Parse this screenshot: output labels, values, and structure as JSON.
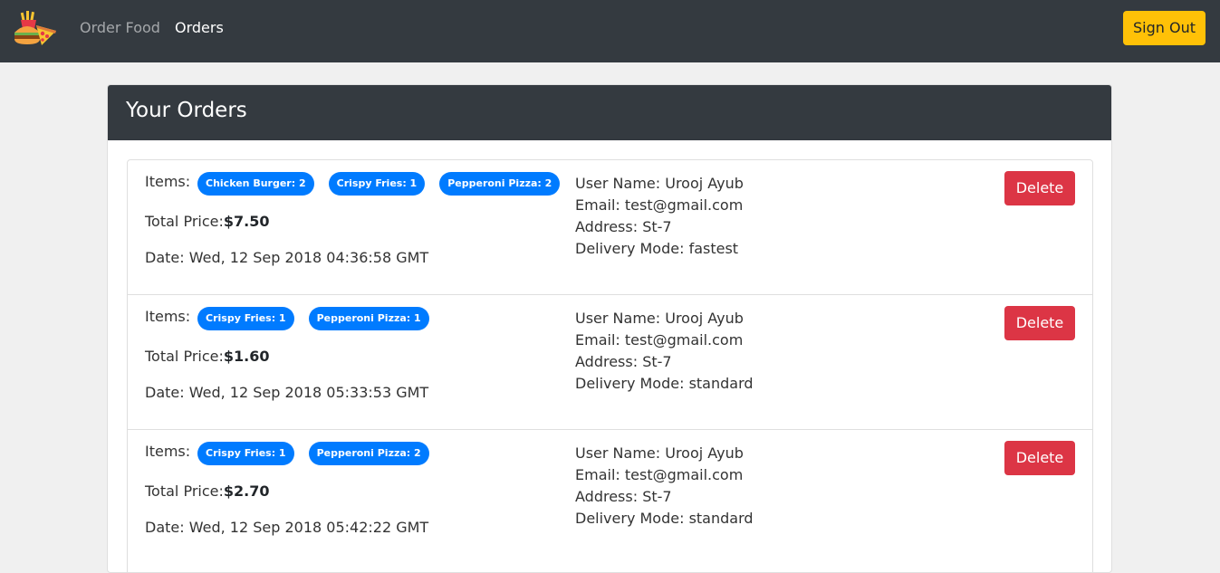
{
  "nav": {
    "logo_icon": "food-logo-icon",
    "links": [
      {
        "label": "Order Food",
        "active": false
      },
      {
        "label": "Orders",
        "active": true
      }
    ],
    "signout_label": "Sign Out"
  },
  "page": {
    "title": "Your Orders"
  },
  "colors": {
    "navbar": "#343a40",
    "badge": "#007bff",
    "delete": "#dc3545",
    "signout": "#ffc107"
  },
  "orders": [
    {
      "items_label": "Items:",
      "items": [
        "Chicken Burger: 2",
        "Crispy Fries: 1",
        "Pepperoni Pizza: 2"
      ],
      "total_label": "Total Price:",
      "total_value": "$7.50",
      "date": "Date: Wed, 12 Sep 2018 04:36:58 GMT",
      "user_name": "User Name: Urooj Ayub",
      "email": "Email: test@gmail.com",
      "address": "Address: St-7",
      "delivery": "Delivery Mode: fastest",
      "delete_label": "Delete"
    },
    {
      "items_label": "Items:",
      "items": [
        "Crispy Fries: 1",
        "Pepperoni Pizza: 1"
      ],
      "total_label": "Total Price:",
      "total_value": "$1.60",
      "date": "Date: Wed, 12 Sep 2018 05:33:53 GMT",
      "user_name": "User Name: Urooj Ayub",
      "email": "Email: test@gmail.com",
      "address": "Address: St-7",
      "delivery": "Delivery Mode: standard",
      "delete_label": "Delete"
    },
    {
      "items_label": "Items:",
      "items": [
        "Crispy Fries: 1",
        "Pepperoni Pizza: 2"
      ],
      "total_label": "Total Price:",
      "total_value": "$2.70",
      "date": "Date: Wed, 12 Sep 2018 05:42:22 GMT",
      "user_name": "User Name: Urooj Ayub",
      "email": "Email: test@gmail.com",
      "address": "Address: St-7",
      "delivery": "Delivery Mode: standard",
      "delete_label": "Delete"
    }
  ]
}
